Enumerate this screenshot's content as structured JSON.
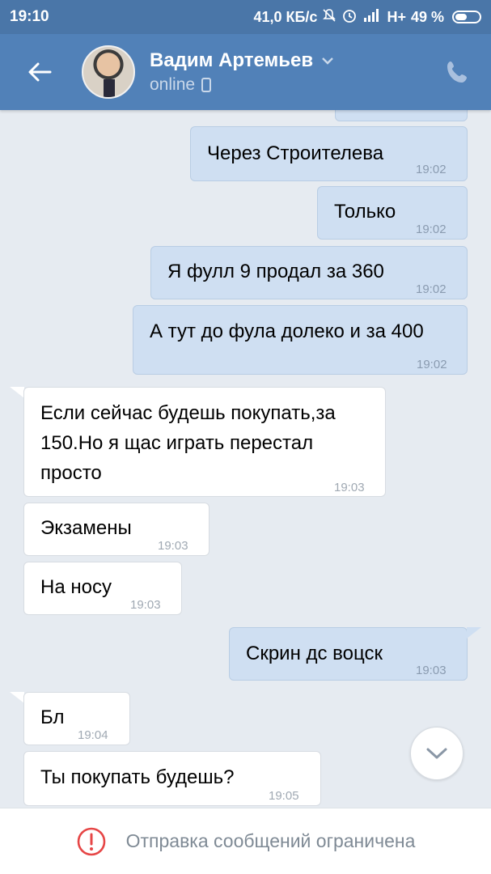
{
  "status_bar": {
    "time": "19:10",
    "network_speed": "41,0 КБ/с",
    "network_type": "H+",
    "battery_percent": "49 %",
    "battery_level": 0.49,
    "icons": [
      "mute-icon",
      "alarm-icon",
      "signal-icon",
      "battery-icon"
    ]
  },
  "header": {
    "name": "Вадим Артемьев",
    "status": "online",
    "icons": [
      "back-arrow-icon",
      "chevron-down-icon",
      "mobile-icon",
      "phone-icon"
    ]
  },
  "messages": [
    {
      "text": "Через Строителева",
      "time": "19:02",
      "direction": "out"
    },
    {
      "text": "Только",
      "time": "19:02",
      "direction": "out"
    },
    {
      "text": "Я фулл 9 продал за 360",
      "time": "19:02",
      "direction": "out"
    },
    {
      "text": "А тут до фула долеко и за 400",
      "time": "19:02",
      "direction": "out"
    },
    {
      "text_lines": [
        "Если сейчас будешь покупать,за",
        "150.Но я щас играть перестал",
        "просто"
      ],
      "time": "19:03",
      "direction": "in"
    },
    {
      "text": "Экзамены",
      "time": "19:03",
      "direction": "in"
    },
    {
      "text": "На носу",
      "time": "19:03",
      "direction": "in"
    },
    {
      "text": "Скрин дс воцск",
      "time": "19:03",
      "direction": "out"
    },
    {
      "text": "Бл",
      "time": "19:04",
      "direction": "in"
    },
    {
      "text": "Ты покупать будешь?",
      "time": "19:05",
      "direction": "in"
    }
  ],
  "bottom_bar": {
    "notice": "Отправка сообщений ограничена",
    "icon": "warning-circle-icon"
  },
  "colors": {
    "header": "#5181b8",
    "statusbar": "#4a76a8",
    "chat_bg": "#e6ebf1",
    "outgoing_bubble": "#cfdff2",
    "incoming_bubble": "#ffffff",
    "warning": "#e64646"
  }
}
